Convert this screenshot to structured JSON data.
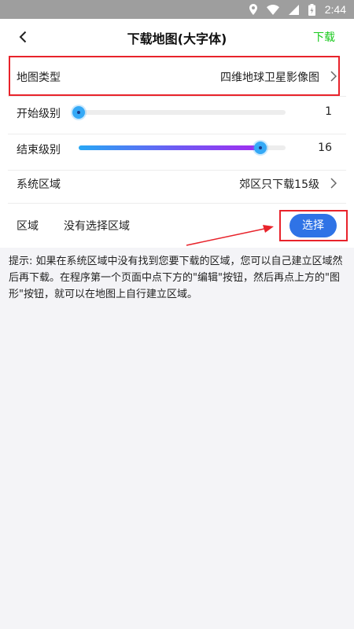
{
  "status_bar": {
    "time": "2:44",
    "icons": [
      "location-icon",
      "wifi-icon",
      "signal-icon",
      "battery-icon"
    ]
  },
  "app_bar": {
    "back_icon": "back-arrow-icon",
    "title": "下载地图(大字体)",
    "action_label": "下载"
  },
  "map_type": {
    "label": "地图类型",
    "value": "四维地球卫星影像图"
  },
  "start_level": {
    "label": "开始级别",
    "value": "1",
    "level_fraction": 0.0
  },
  "end_level": {
    "label": "结束级别",
    "value": "16",
    "level_fraction": 0.88
  },
  "system_region": {
    "label": "系统区域",
    "value": "郊区只下载15级"
  },
  "region": {
    "label": "区域",
    "value": "没有选择区域",
    "button_label": "选择"
  },
  "hint": {
    "text": "提示: 如果在系统区域中没有找到您要下载的区域，您可以自己建立区域然后再下载。在程序第一个页面中点下方的\"编辑\"按钮，然后再点上方的\"图形\"按钮，就可以在地图上自行建立区域。"
  },
  "colors": {
    "accent_green": "#17c91b",
    "button_blue": "#2f73e6",
    "annotation_red": "#e8232b"
  }
}
